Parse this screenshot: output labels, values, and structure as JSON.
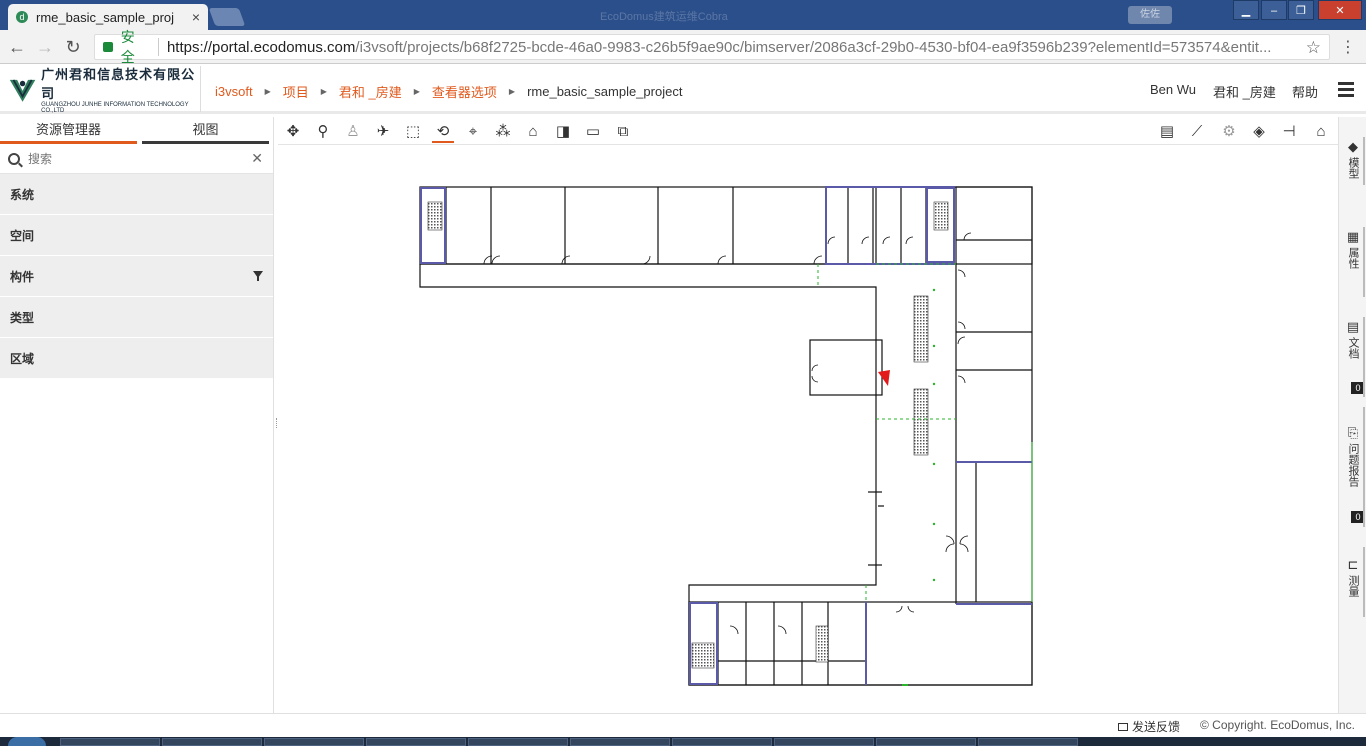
{
  "browser": {
    "tab_title": "rme_basic_sample_proj",
    "tab_close": "×",
    "window_title": "EcoDomus建筑运维Cobra",
    "user_badge": "佐佐",
    "secure_label": "安全",
    "url_host": "https://portal.ecodomus.com",
    "url_path": "/i3vsoft/projects/b68f2725-bcde-46a0-9983-c26b5f9ae90c/bimserver/2086a3cf-29b0-4530-bf04-ea9f3596b239?elementId=573574&entit..."
  },
  "logo": {
    "cn": "广州君和信息技术有限公司",
    "en": "GUANGZHOU JUNHE INFORMATION TECHNOLOGY CO.,LTD"
  },
  "breadcrumb": {
    "items": [
      "i3vsoft",
      "项目",
      "君和 _房建",
      "查看器选项",
      "rme_basic_sample_project"
    ]
  },
  "header": {
    "user": "Ben Wu",
    "project": "君和 _房建",
    "help": "帮助"
  },
  "left_panel": {
    "tab_explorer": "资源管理器",
    "tab_view": "视图",
    "search_placeholder": "搜索",
    "items": [
      "系统",
      "空间",
      "构件",
      "类型",
      "区域"
    ]
  },
  "toolbar": {
    "left_icons": [
      "move-icon",
      "walk-icon",
      "person-icon",
      "fly-icon",
      "section-box-icon",
      "orbit-icon",
      "focus-icon",
      "explode-icon",
      "home-icon",
      "add-view-icon",
      "measure-icon",
      "clip-icon"
    ],
    "right_icons": [
      "properties-icon",
      "chart-icon",
      "settings-icon",
      "layers-icon",
      "split-icon",
      "fullscreen-icon"
    ]
  },
  "right_sidebar": {
    "items": [
      {
        "label": "模型",
        "count": null
      },
      {
        "label": "属性",
        "count": null
      },
      {
        "label": "文档",
        "count": "0"
      },
      {
        "label": "问题报告",
        "count": "0"
      },
      {
        "label": "测量",
        "count": null
      }
    ]
  },
  "footer": {
    "feedback": "发送反馈",
    "copyright": "© Copyright. EcoDomus, Inc."
  },
  "colors": {
    "accent": "#e05a1e",
    "titlebar": "#2b4f8a",
    "secure": "#1a8a3a"
  }
}
